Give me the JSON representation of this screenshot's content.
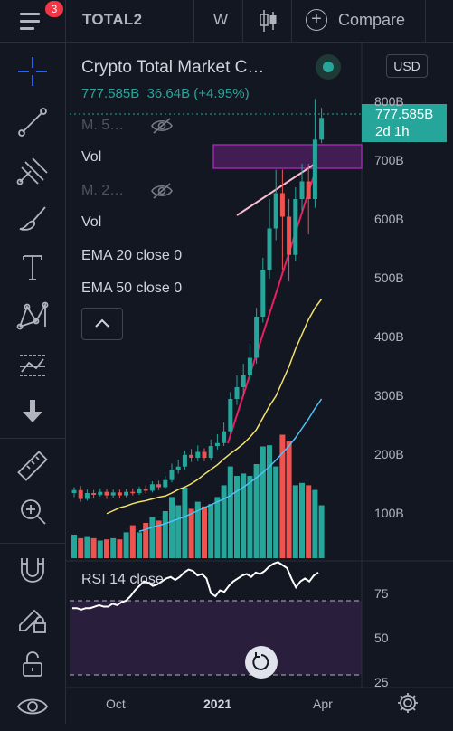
{
  "toolbar": {
    "notification_count": "3",
    "symbol": "TOTAL2",
    "interval": "W",
    "compare_label": "Compare",
    "icons": [
      "menu-icon",
      "candlestick-icon",
      "plus-circle-icon"
    ]
  },
  "left_tools": [
    "crosshair-icon",
    "trend-line-icon",
    "pitchfork-icon",
    "brush-icon",
    "text-icon",
    "pattern-icon",
    "forecast-icon",
    "arrow-down-icon",
    "ruler-icon",
    "zoom-in-icon",
    "magnet-icon",
    "lock-pencil-icon",
    "unlock-icon",
    "eye-icon"
  ],
  "legend": {
    "title": "Crypto Total Market C…",
    "price": "777.585B",
    "change": "36.64B (+4.95%)",
    "currency": "USD",
    "indicators": [
      {
        "label": "M. 5…",
        "hidden": true
      },
      {
        "label": "Vol",
        "hidden": false
      },
      {
        "label": "M. 2…",
        "hidden": true
      },
      {
        "label": "Vol",
        "hidden": false
      },
      {
        "label": "EMA 20 close 0",
        "hidden": false
      },
      {
        "label": "EMA 50 close 0",
        "hidden": false
      }
    ]
  },
  "price_tag": {
    "value": "777.585B",
    "countdown": "2d 1h"
  },
  "rsi": {
    "label": "RSI 14 close",
    "levels": [
      "75",
      "50",
      "25"
    ]
  },
  "colors": {
    "up": "#26a69a",
    "down": "#ef5350",
    "ema20": "#f5e26b",
    "ema50": "#4fc3f7",
    "rsi_band": "#2a1e3d",
    "trend_line": "#e91e63",
    "zone": "#9c27b0"
  },
  "chart_data": {
    "type": "candlestick",
    "title": "Crypto Total Market C…",
    "y_ticks": [
      "800B",
      "700B",
      "600B",
      "500B",
      "400B",
      "300B",
      "200B",
      "100B"
    ],
    "y_tick_values": [
      800,
      700,
      600,
      500,
      400,
      300,
      200,
      100
    ],
    "x_ticks": [
      "Oct",
      "2021",
      "Apr"
    ],
    "ylim": [
      20,
      820
    ],
    "candles": [
      {
        "o": 140,
        "c": 145,
        "h": 150,
        "l": 133
      },
      {
        "o": 145,
        "c": 130,
        "h": 152,
        "l": 125
      },
      {
        "o": 130,
        "c": 140,
        "h": 146,
        "l": 127
      },
      {
        "o": 140,
        "c": 137,
        "h": 145,
        "l": 131
      },
      {
        "o": 137,
        "c": 142,
        "h": 148,
        "l": 134
      },
      {
        "o": 142,
        "c": 136,
        "h": 147,
        "l": 130
      },
      {
        "o": 136,
        "c": 141,
        "h": 146,
        "l": 132
      },
      {
        "o": 141,
        "c": 136,
        "h": 146,
        "l": 131
      },
      {
        "o": 136,
        "c": 142,
        "h": 147,
        "l": 133
      },
      {
        "o": 142,
        "c": 140,
        "h": 148,
        "l": 136
      },
      {
        "o": 140,
        "c": 147,
        "h": 151,
        "l": 137
      },
      {
        "o": 147,
        "c": 144,
        "h": 153,
        "l": 139
      },
      {
        "o": 144,
        "c": 155,
        "h": 160,
        "l": 141
      },
      {
        "o": 155,
        "c": 150,
        "h": 161,
        "l": 145
      },
      {
        "o": 150,
        "c": 162,
        "h": 169,
        "l": 148
      },
      {
        "o": 162,
        "c": 180,
        "h": 190,
        "l": 158
      },
      {
        "o": 180,
        "c": 185,
        "h": 197,
        "l": 173
      },
      {
        "o": 185,
        "c": 205,
        "h": 212,
        "l": 180
      },
      {
        "o": 205,
        "c": 200,
        "h": 215,
        "l": 193
      },
      {
        "o": 200,
        "c": 210,
        "h": 221,
        "l": 194
      },
      {
        "o": 210,
        "c": 200,
        "h": 216,
        "l": 194
      },
      {
        "o": 200,
        "c": 220,
        "h": 231,
        "l": 195
      },
      {
        "o": 220,
        "c": 225,
        "h": 240,
        "l": 214
      },
      {
        "o": 225,
        "c": 245,
        "h": 260,
        "l": 220
      },
      {
        "o": 245,
        "c": 300,
        "h": 312,
        "l": 240
      },
      {
        "o": 300,
        "c": 320,
        "h": 340,
        "l": 290
      },
      {
        "o": 320,
        "c": 340,
        "h": 360,
        "l": 305
      },
      {
        "o": 340,
        "c": 370,
        "h": 395,
        "l": 330
      },
      {
        "o": 370,
        "c": 440,
        "h": 455,
        "l": 360
      },
      {
        "o": 440,
        "c": 520,
        "h": 540,
        "l": 430
      },
      {
        "o": 520,
        "c": 590,
        "h": 640,
        "l": 505
      },
      {
        "o": 590,
        "c": 650,
        "h": 690,
        "l": 570
      },
      {
        "o": 650,
        "c": 610,
        "h": 690,
        "l": 520
      },
      {
        "o": 610,
        "c": 545,
        "h": 640,
        "l": 500
      },
      {
        "o": 545,
        "c": 640,
        "h": 660,
        "l": 535
      },
      {
        "o": 640,
        "c": 670,
        "h": 700,
        "l": 620
      },
      {
        "o": 670,
        "c": 640,
        "h": 700,
        "l": 580
      },
      {
        "o": 640,
        "c": 741,
        "h": 810,
        "l": 625
      },
      {
        "o": 741,
        "c": 778,
        "h": 795,
        "l": 735
      }
    ],
    "volume": [
      0.2,
      0.17,
      0.18,
      0.17,
      0.15,
      0.16,
      0.17,
      0.16,
      0.22,
      0.28,
      0.22,
      0.3,
      0.35,
      0.32,
      0.4,
      0.52,
      0.45,
      0.6,
      0.42,
      0.48,
      0.44,
      0.46,
      0.52,
      0.62,
      0.78,
      0.7,
      0.72,
      0.7,
      0.8,
      0.95,
      0.96,
      0.78,
      1.05,
      1.0,
      0.62,
      0.64,
      0.62,
      0.58,
      0.45
    ],
    "ema20": [
      105,
      110,
      115,
      118,
      122,
      125,
      127,
      130,
      133,
      135,
      140,
      146,
      150,
      156,
      163,
      172,
      180,
      188,
      198,
      207,
      215,
      224,
      235,
      248,
      268,
      288,
      305,
      330,
      355,
      385,
      410,
      435,
      455,
      470
    ],
    "ema50": [
      75,
      78,
      82,
      85,
      88,
      92,
      96,
      100,
      105,
      110,
      115,
      120,
      125,
      130,
      136,
      143,
      150,
      158,
      166,
      175,
      185,
      196,
      208,
      220,
      234,
      250,
      266,
      284,
      300
    ],
    "rsi": [
      70,
      70,
      69,
      70,
      70,
      71,
      72,
      71,
      71,
      73,
      72,
      74,
      75,
      78,
      82,
      85,
      88,
      87,
      85,
      86,
      88,
      90,
      91,
      89,
      91,
      94,
      96,
      95,
      92,
      93,
      90,
      80,
      78,
      82,
      81,
      85,
      88,
      90,
      92,
      93,
      91,
      94,
      93,
      95,
      98,
      100,
      101,
      99,
      97,
      90,
      84,
      88,
      90,
      88,
      92,
      94
    ]
  }
}
